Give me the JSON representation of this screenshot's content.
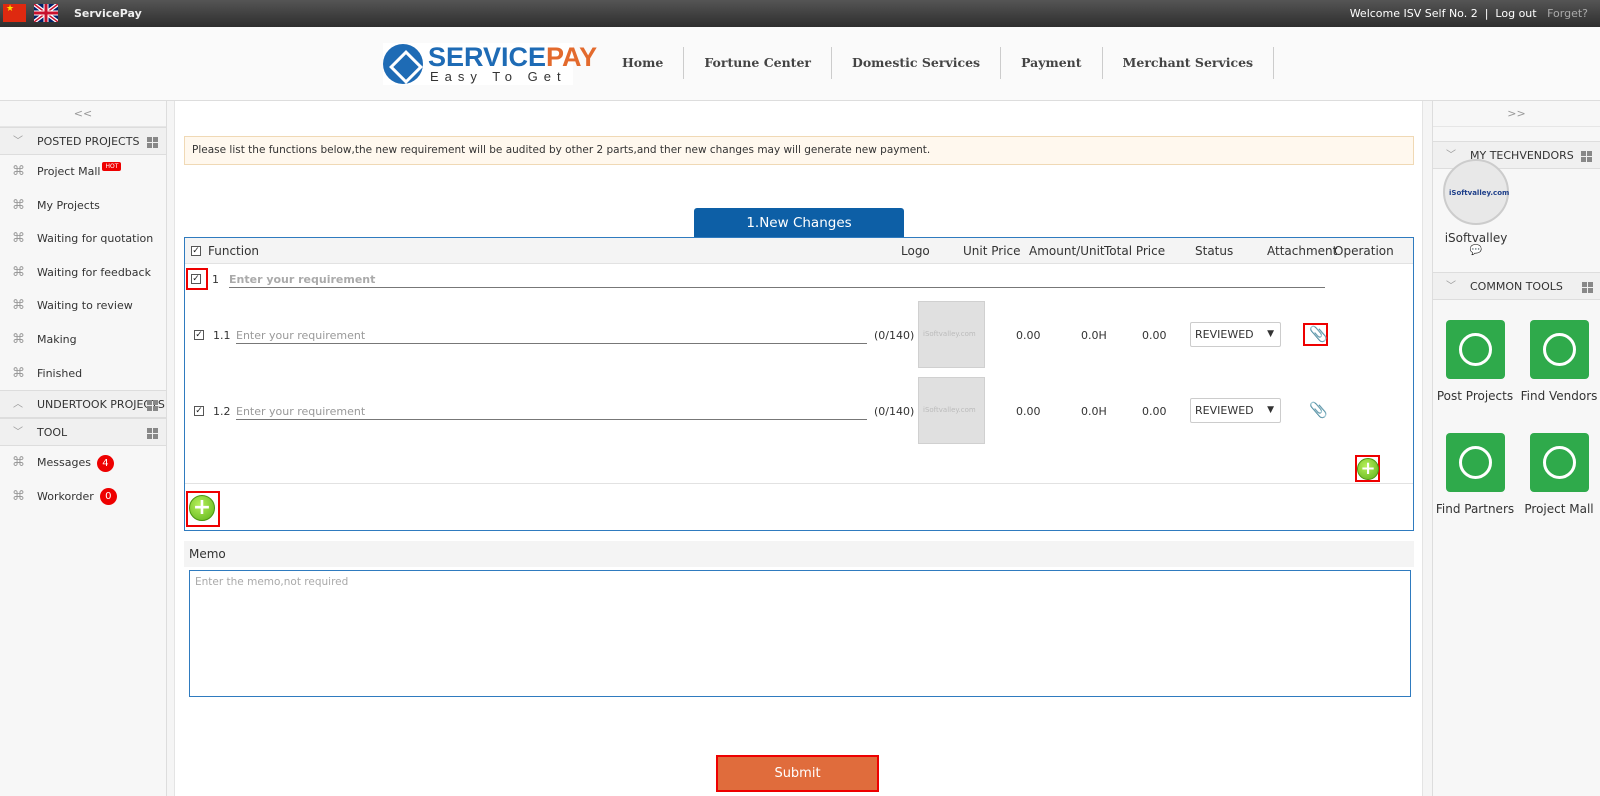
{
  "topbar": {
    "brand": "ServicePay",
    "welcome": "Welcome ISV Self No. 2",
    "sep": "|",
    "logout": "Log out",
    "forget": "Forget?"
  },
  "logo": {
    "service": "SERVICE",
    "pay": "PAY",
    "tagline": "Easy To Get"
  },
  "nav": [
    "Home",
    "Fortune Center",
    "Domestic Services",
    "Payment",
    "Merchant Services"
  ],
  "left": {
    "collapse": "<<",
    "posted_title": "POSTED PROJECTS",
    "posted_items": [
      "Project Mall",
      "My Projects",
      "Waiting for quotation",
      "Waiting for feedback",
      "Waiting to review",
      "Making",
      "Finished"
    ],
    "hot": "HOT",
    "undertook_title": "UNDERTOOK PROJECTS",
    "tool_title": "TOOL",
    "messages": "Messages",
    "messages_count": "4",
    "workorder": "Workorder",
    "workorder_count": "0"
  },
  "right": {
    "collapse": ">>",
    "techvendors_title": "MY TECHVENDORS",
    "vendor_logo": "iSoftvalley.com",
    "vendor_name": "iSoftvalley",
    "common_tools_title": "COMMON TOOLS",
    "tools": [
      "Post Projects",
      "Find Vendors",
      "Find Partners",
      "Project Mall"
    ]
  },
  "main": {
    "notice": "Please list the functions below,the new requirement will be audited by other 2 parts,and ther new changes may will generate new payment.",
    "tab": "1.New Changes",
    "headers": {
      "function": "Function",
      "logo": "Logo",
      "unit_price": "Unit Price",
      "amount_unit": "Amount/Unit",
      "total_price": "Total Price",
      "status": "Status",
      "attachment": "Attachment",
      "operation": "Operation"
    },
    "group": {
      "num": "1",
      "placeholder": "Enter your requirement"
    },
    "rows": [
      {
        "num": "1.1",
        "placeholder": "Enter your requirement",
        "count": "(0/140)",
        "thumb": "iSoftvalley.com",
        "unit_price": "0.00",
        "amount": "0.0H",
        "total": "0.00",
        "status": "REVIEWED"
      },
      {
        "num": "1.2",
        "placeholder": "Enter your requirement",
        "count": "(0/140)",
        "thumb": "iSoftvalley.com",
        "unit_price": "0.00",
        "amount": "0.0H",
        "total": "0.00",
        "status": "REVIEWED"
      }
    ],
    "memo_title": "Memo",
    "memo_placeholder": "Enter the memo,not required",
    "submit": "Submit"
  }
}
